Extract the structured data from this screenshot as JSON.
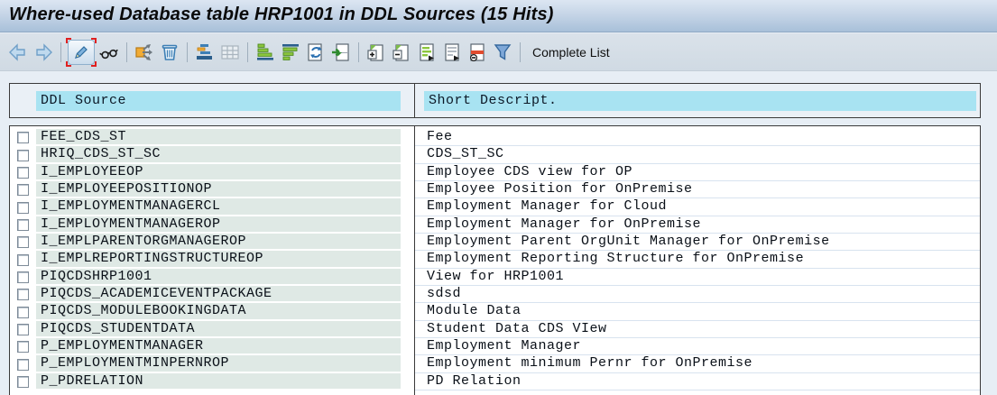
{
  "title": "Where-used Database table HRP1001 in DDL Sources (15 Hits)",
  "toolbar": {
    "complete_list_label": "Complete List",
    "icons": [
      {
        "name": "back-icon"
      },
      {
        "name": "forward-icon"
      },
      {
        "name": "edit-pencil-icon",
        "state": "selected"
      },
      {
        "name": "display-glasses-icon"
      },
      {
        "name": "where-used-icon"
      },
      {
        "name": "delete-trash-icon"
      },
      {
        "name": "stacked-bars-icon"
      },
      {
        "name": "table-icon",
        "state": "disabled"
      },
      {
        "name": "sort-ascending-icon"
      },
      {
        "name": "sort-descending-icon"
      },
      {
        "name": "refresh-icon"
      },
      {
        "name": "choose-page-icon"
      },
      {
        "name": "expand-icon"
      },
      {
        "name": "collapse-icon"
      },
      {
        "name": "detail-list-icon"
      },
      {
        "name": "overview-list-icon"
      },
      {
        "name": "hide-lines-icon"
      },
      {
        "name": "filter-icon"
      }
    ]
  },
  "table": {
    "columns": [
      "DDL Source",
      "Short Descript."
    ],
    "hits": 15,
    "rows": [
      {
        "ddl_source": "FEE_CDS_ST",
        "description": "Fee"
      },
      {
        "ddl_source": "HRIQ_CDS_ST_SC",
        "description": "CDS_ST_SC"
      },
      {
        "ddl_source": "I_EMPLOYEEOP",
        "description": "Employee CDS view for OP"
      },
      {
        "ddl_source": "I_EMPLOYEEPOSITIONOP",
        "description": "Employee Position for OnPremise"
      },
      {
        "ddl_source": "I_EMPLOYMENTMANAGERCL",
        "description": "Employment Manager for Cloud"
      },
      {
        "ddl_source": "I_EMPLOYMENTMANAGEROP",
        "description": "Employment Manager for OnPremise"
      },
      {
        "ddl_source": "I_EMPLPARENTORGMANAGEROP",
        "description": "Employment Parent OrgUnit Manager for OnPremise"
      },
      {
        "ddl_source": "I_EMPLREPORTINGSTRUCTUREOP",
        "description": "Employment Reporting Structure for OnPremise"
      },
      {
        "ddl_source": "PIQCDSHRP1001",
        "description": "View for HRP1001"
      },
      {
        "ddl_source": "PIQCDS_ACADEMICEVENTPACKAGE",
        "description": "sdsd"
      },
      {
        "ddl_source": "PIQCDS_MODULEBOOKINGDATA",
        "description": "Module Data"
      },
      {
        "ddl_source": "PIQCDS_STUDENTDATA",
        "description": "Student Data CDS VIew"
      },
      {
        "ddl_source": "P_EMPLOYMENTMANAGER",
        "description": "Employment Manager"
      },
      {
        "ddl_source": "P_EMPLOYMENTMINPERNROP",
        "description": "Employment minimum Pernr for OnPremise"
      },
      {
        "ddl_source": "P_PDRELATION",
        "description": "PD Relation"
      }
    ]
  },
  "colors": {
    "header_highlight": "#A8E3F2",
    "row_cell": "#DFE9E5",
    "titlebar_top": "#DCE6F2",
    "titlebar_bottom": "#A8C0D9",
    "toolbar_bg": "#D2DCE5",
    "page_bg": "#E7EEF5",
    "border": "#3A3A3A",
    "selected_corner": "#E02020"
  }
}
